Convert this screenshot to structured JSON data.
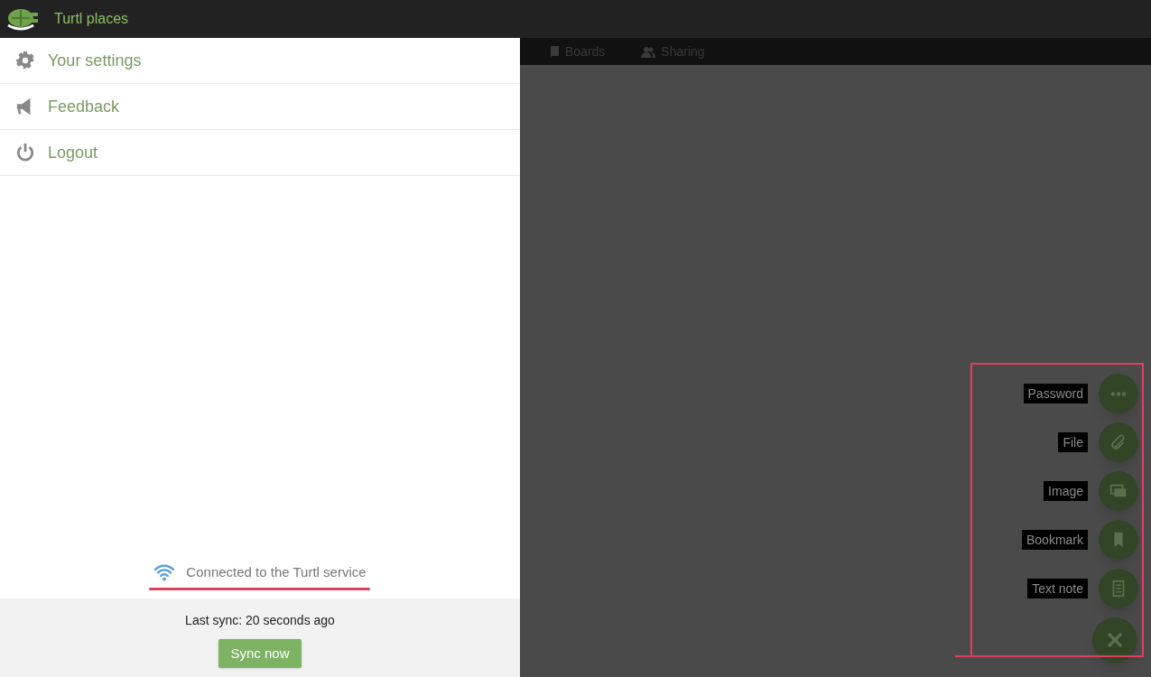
{
  "app_bar": {
    "title": "Turtl places"
  },
  "menu": [
    {
      "kind": "settings",
      "label": "Your settings"
    },
    {
      "kind": "feedback",
      "label": "Feedback"
    },
    {
      "kind": "logout",
      "label": "Logout"
    }
  ],
  "connection": {
    "status": "Connected to the Turtl service"
  },
  "sync": {
    "last_sync": "Last sync: 20 seconds ago",
    "button": "Sync now"
  },
  "tabs": [
    {
      "kind": "boards",
      "label": "Boards"
    },
    {
      "kind": "sharing",
      "label": "Sharing"
    }
  ],
  "add_actions": [
    {
      "kind": "password",
      "label": "Password"
    },
    {
      "kind": "file",
      "label": "File"
    },
    {
      "kind": "image",
      "label": "Image"
    },
    {
      "kind": "bookmark",
      "label": "Bookmark"
    },
    {
      "kind": "note",
      "label": "Text note"
    }
  ]
}
